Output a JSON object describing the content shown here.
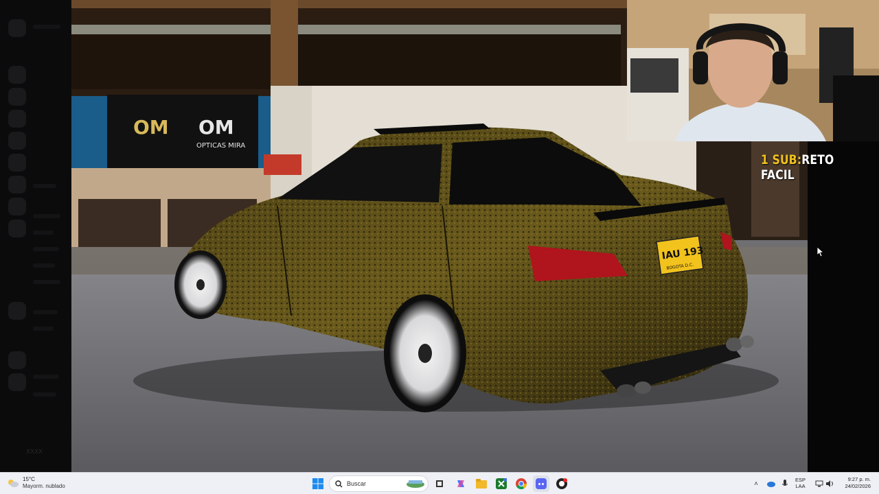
{
  "overlay": {
    "prefix": "1 SUB:",
    "challenge": "RETO FACIL",
    "prefix_color": "#f2c21d",
    "challenge_color": "#ffffff"
  },
  "photo": {
    "banner_left": "OPTICAS MIRA",
    "logo_text": "OM",
    "plate": "IAU 193",
    "plate_city": "BOGOTA D.C."
  },
  "sidebar": {
    "user_label": "XXXX"
  },
  "taskbar": {
    "weather": {
      "temp": "15°C",
      "condition": "Mayorm. nublado",
      "icon": "cloud-sun-icon"
    },
    "search_placeholder": "Buscar",
    "apps": [
      "start-icon",
      "search-icon",
      "news-widget-icon",
      "task-view-icon",
      "copilot-icon",
      "file-explorer-icon",
      "xbox-icon",
      "chrome-icon",
      "discord-icon",
      "obs-icon"
    ],
    "lang": {
      "line1": "ESP",
      "line2": "LAA"
    },
    "time": "9:27 p. m.",
    "date": "24/02/2026"
  }
}
